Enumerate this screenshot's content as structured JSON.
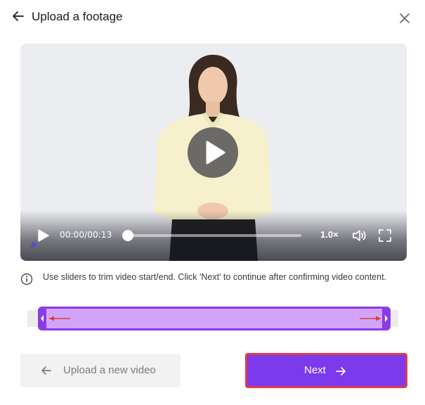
{
  "header": {
    "title": "Upload a footage",
    "back_icon": "arrow-left-icon",
    "close_icon": "close-icon"
  },
  "player": {
    "current_time": "00:00",
    "duration": "00:13",
    "time_display": "00:00/00:13",
    "speed": "1.0×",
    "progress_fraction": 0.0,
    "icons": [
      "play-icon",
      "volume-icon",
      "fullscreen-icon"
    ]
  },
  "info": {
    "text": "Use sliders to trim video start/end. Click 'Next' to continue after confirming video content.",
    "icon": "info-icon"
  },
  "trim": {
    "start_fraction": 0.0,
    "end_fraction": 1.0
  },
  "buttons": {
    "upload_label": "Upload a new video",
    "next_label": "Next"
  },
  "colors": {
    "accent": "#7c3aed",
    "trim_fill": "#d1a4f9",
    "trim_border": "#8c3be4",
    "highlight_border": "#e23a49",
    "trim_arrow": "#e53935"
  }
}
